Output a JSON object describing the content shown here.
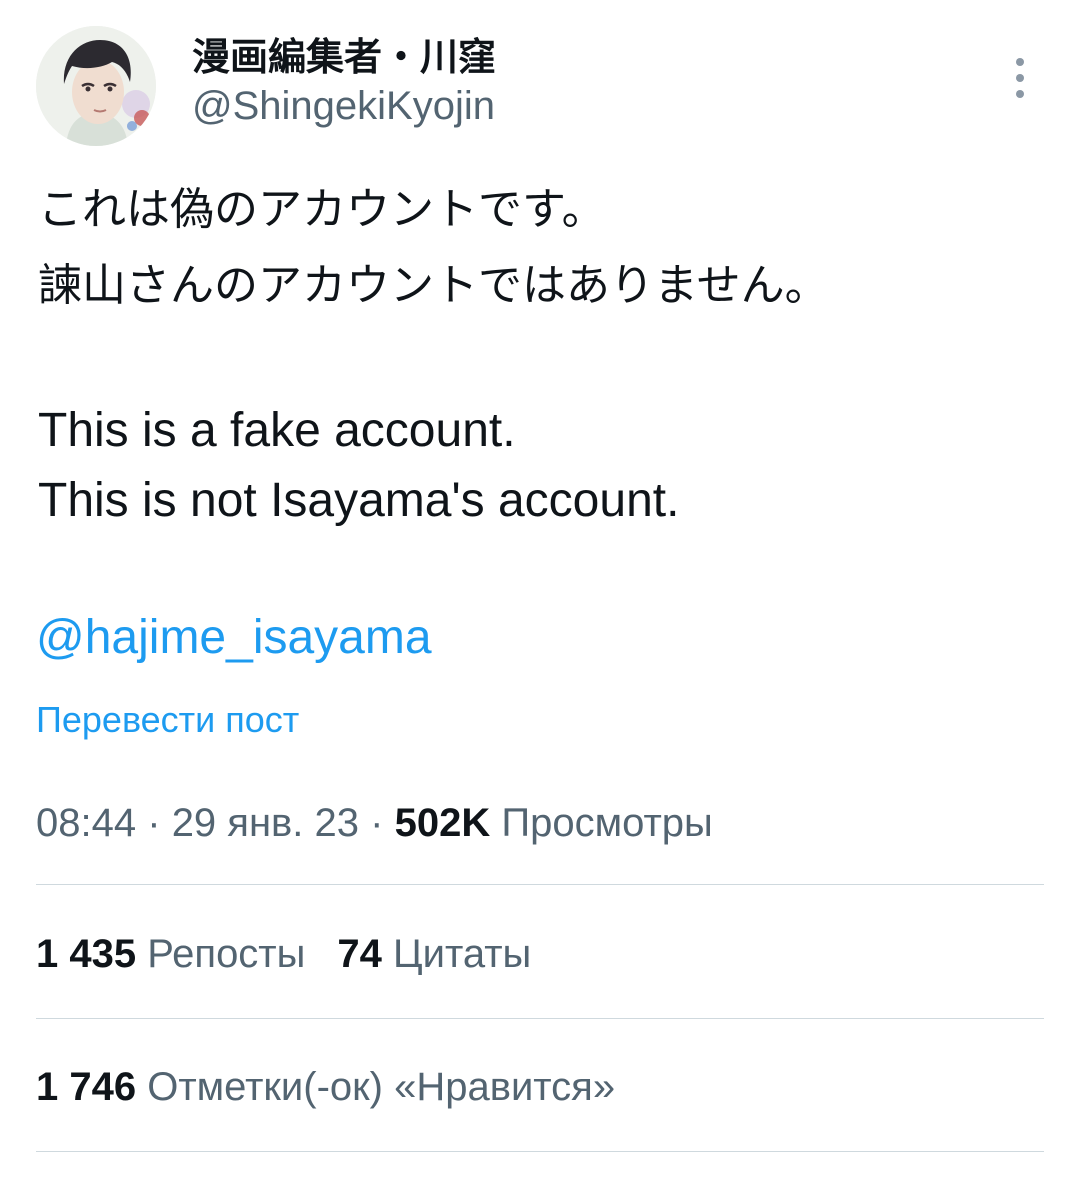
{
  "author": {
    "display_name": "漫画編集者・川窪",
    "handle": "@ShingekiKyojin"
  },
  "icons": {
    "avatar": "profile-avatar",
    "more": "more-vertical-icon"
  },
  "body": {
    "jp_line_1": "これは偽のアカウントです。",
    "jp_line_2": "諫山さんのアカウントではありません。",
    "en_line_1": "This is a fake account.",
    "en_line_2": "This is not Isayama's account.",
    "mention": "@hajime_isayama"
  },
  "translate_label": "Перевести пост",
  "meta": {
    "time": "08:44",
    "separator": "·",
    "date": "29 янв. 23",
    "views_count": "502K",
    "views_label": "Просмотры"
  },
  "stats": {
    "reposts_count": "1 435",
    "reposts_label": "Репосты",
    "quotes_count": "74",
    "quotes_label": "Цитаты",
    "likes_count": "1 746",
    "likes_label": "Отметки(-ок) «Нравится»"
  },
  "colors": {
    "accent": "#1d9bf0",
    "text_primary": "#0f1419",
    "text_secondary": "#536471",
    "divider": "#cfd9de"
  }
}
